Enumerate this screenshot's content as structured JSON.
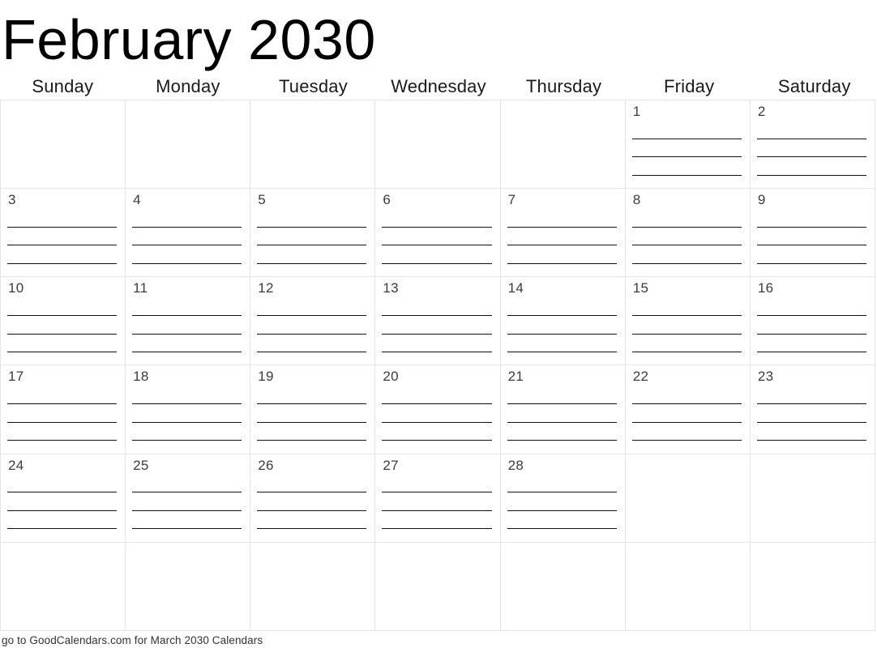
{
  "title": "February 2030",
  "weekdays": [
    {
      "label": "Sunday"
    },
    {
      "label": "Monday"
    },
    {
      "label": "Tuesday"
    },
    {
      "label": "Wednesday"
    },
    {
      "label": "Thursday"
    },
    {
      "label": "Friday"
    },
    {
      "label": "Saturday"
    }
  ],
  "grid": {
    "columns": 7,
    "rows": 6,
    "lines_per_day": 4,
    "cells": [
      {
        "day": "",
        "empty": true
      },
      {
        "day": "",
        "empty": true
      },
      {
        "day": "",
        "empty": true
      },
      {
        "day": "",
        "empty": true
      },
      {
        "day": "",
        "empty": true
      },
      {
        "day": "1",
        "empty": false
      },
      {
        "day": "2",
        "empty": false
      },
      {
        "day": "3",
        "empty": false
      },
      {
        "day": "4",
        "empty": false
      },
      {
        "day": "5",
        "empty": false
      },
      {
        "day": "6",
        "empty": false
      },
      {
        "day": "7",
        "empty": false
      },
      {
        "day": "8",
        "empty": false
      },
      {
        "day": "9",
        "empty": false
      },
      {
        "day": "10",
        "empty": false
      },
      {
        "day": "11",
        "empty": false
      },
      {
        "day": "12",
        "empty": false
      },
      {
        "day": "13",
        "empty": false
      },
      {
        "day": "14",
        "empty": false
      },
      {
        "day": "15",
        "empty": false
      },
      {
        "day": "16",
        "empty": false
      },
      {
        "day": "17",
        "empty": false
      },
      {
        "day": "18",
        "empty": false
      },
      {
        "day": "19",
        "empty": false
      },
      {
        "day": "20",
        "empty": false
      },
      {
        "day": "21",
        "empty": false
      },
      {
        "day": "22",
        "empty": false
      },
      {
        "day": "23",
        "empty": false
      },
      {
        "day": "24",
        "empty": false
      },
      {
        "day": "25",
        "empty": false
      },
      {
        "day": "26",
        "empty": false
      },
      {
        "day": "27",
        "empty": false
      },
      {
        "day": "28",
        "empty": false
      },
      {
        "day": "",
        "empty": true
      },
      {
        "day": "",
        "empty": true
      },
      {
        "day": "",
        "empty": true
      },
      {
        "day": "",
        "empty": true
      },
      {
        "day": "",
        "empty": true
      },
      {
        "day": "",
        "empty": true
      },
      {
        "day": "",
        "empty": true
      },
      {
        "day": "",
        "empty": true
      },
      {
        "day": "",
        "empty": true
      }
    ]
  },
  "footer": {
    "text": "go to GoodCalendars.com for March 2030 Calendars"
  },
  "colors": {
    "background": "#ffffff",
    "title_text": "#000000",
    "weekday_text": "#1a1a1a",
    "day_number_text": "#3c3c3c",
    "cell_border": "#e4e4e4",
    "write_line": "#111111",
    "footer_text": "#333333"
  }
}
